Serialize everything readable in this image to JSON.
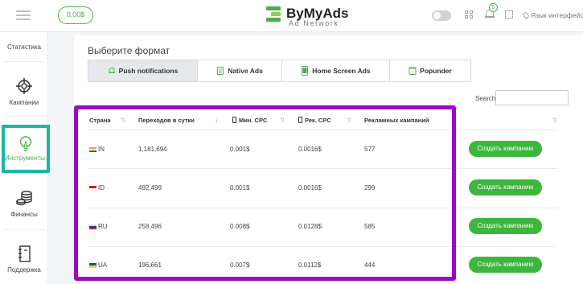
{
  "header": {
    "balance": "0.00$",
    "logo_title": "ByMyAds",
    "logo_subtitle": "Ad Network",
    "notifications_count": "5",
    "language": "Язык интерфейса"
  },
  "sidebar": {
    "items": [
      {
        "label": "Статистика"
      },
      {
        "label": "Кампании"
      },
      {
        "label": "Инструменты"
      },
      {
        "label": "Финансы"
      },
      {
        "label": "Поддержка"
      }
    ]
  },
  "main": {
    "format_title": "Выберите формат",
    "tabs": [
      {
        "label": "Push notifications",
        "icon": "bell-icon",
        "active": true
      },
      {
        "label": "Native Ads",
        "icon": "document-icon",
        "active": false
      },
      {
        "label": "Home Screen Ads",
        "icon": "phone-icon",
        "active": false
      },
      {
        "label": "Popunder",
        "icon": "window-icon",
        "active": false
      }
    ],
    "search_label": "Search:",
    "search_value": "",
    "table": {
      "headers": [
        "Страна",
        "Переходов в сутки",
        "Мин. CPC",
        "Рек. CPC",
        "Рекламных кампаний"
      ],
      "rows": [
        {
          "country": "IN",
          "clicks": "1,181,694",
          "min_cpc": "0.001$",
          "rec_cpc": "0.0016$",
          "campaigns": "577",
          "action": "Создать кампанию"
        },
        {
          "country": "ID",
          "clicks": "492,499",
          "min_cpc": "0.001$",
          "rec_cpc": "0.0016$",
          "campaigns": "299",
          "action": "Создать кампанию"
        },
        {
          "country": "RU",
          "clicks": "258,496",
          "min_cpc": "0.008$",
          "rec_cpc": "0.0128$",
          "campaigns": "585",
          "action": "Создать кампанию"
        },
        {
          "country": "UA",
          "clicks": "196,661",
          "min_cpc": "0.007$",
          "rec_cpc": "0.0112$",
          "campaigns": "444",
          "action": "Создать кампанию"
        }
      ]
    }
  },
  "colors": {
    "accent": "#3db63d",
    "highlight_sidebar": "#19b8a6",
    "highlight_table": "#9b09c7"
  }
}
